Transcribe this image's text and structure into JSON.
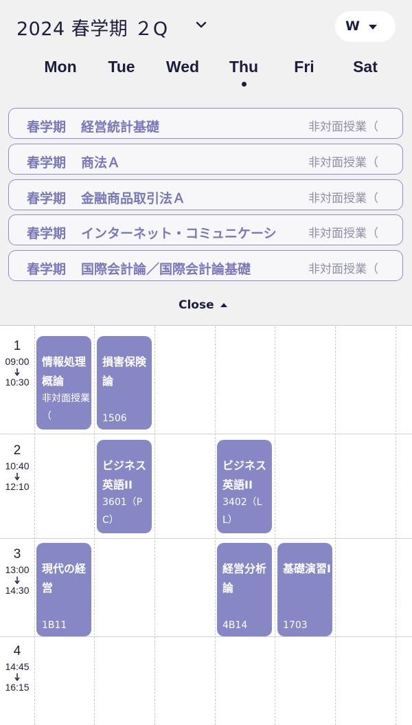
{
  "header": {
    "term_title": "2024 春学期 ２Q",
    "view_button": "W",
    "close_label": "Close"
  },
  "days": [
    {
      "label": "Mon",
      "today": false
    },
    {
      "label": "Tue",
      "today": false
    },
    {
      "label": "Wed",
      "today": false
    },
    {
      "label": "Thu",
      "today": true
    },
    {
      "label": "Fri",
      "today": false
    },
    {
      "label": "Sat",
      "today": false
    }
  ],
  "unscheduled": [
    {
      "term": "春学期",
      "title": "経営統計基礎",
      "mode": "非対面授業（"
    },
    {
      "term": "春学期",
      "title": "商法Ａ",
      "mode": "非対面授業（"
    },
    {
      "term": "春学期",
      "title": "金融商品取引法Ａ",
      "mode": "非対面授業（"
    },
    {
      "term": "春学期",
      "title": "インターネット・コミュニケーシ",
      "mode": "非対面授業（"
    },
    {
      "term": "春学期",
      "title": "国際会計論／国際会計論基礎",
      "mode": "非対面授業（"
    }
  ],
  "periods": [
    {
      "num": "1",
      "start": "09:00",
      "end": "10:30"
    },
    {
      "num": "2",
      "start": "10:40",
      "end": "12:10"
    },
    {
      "num": "3",
      "start": "13:00",
      "end": "14:30"
    },
    {
      "num": "4",
      "start": "14:45",
      "end": "16:15"
    }
  ],
  "classes": [
    {
      "day": "Mon",
      "period": "1",
      "name": "情報処理概論",
      "room": "非対面授業（"
    },
    {
      "day": "Tue",
      "period": "1",
      "name": "損害保険論",
      "room": "1506"
    },
    {
      "day": "Tue",
      "period": "2",
      "name": "ビジネス英語II",
      "room": "3601（PC）"
    },
    {
      "day": "Thu",
      "period": "2",
      "name": "ビジネス英語II",
      "room": "3402（LL）"
    },
    {
      "day": "Mon",
      "period": "3",
      "name": "現代の経営",
      "room": "1B11"
    },
    {
      "day": "Thu",
      "period": "3",
      "name": "経営分析論",
      "room": "4B14"
    },
    {
      "day": "Fri",
      "period": "3",
      "name": "基礎演習I",
      "room": "1703"
    }
  ],
  "colors": {
    "class_block": "#8887c5",
    "card_text": "#7a78b8",
    "header_bg": "#f1f1f2"
  }
}
